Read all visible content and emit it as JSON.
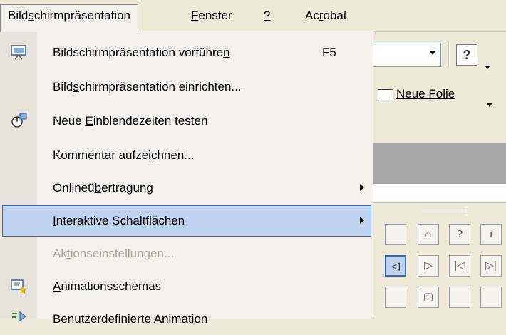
{
  "menubar": {
    "items": [
      {
        "label": "Bildschirmpräsentation",
        "active": true
      },
      {
        "label": "Fenster"
      },
      {
        "label": "?"
      },
      {
        "label": "Acrobat"
      }
    ]
  },
  "menu": {
    "items": [
      {
        "label": "Bildschirmpräsentation vorführen",
        "shortcut": "F5",
        "icon": "slideshow-icon"
      },
      {
        "label": "Bildschirmpräsentation einrichten..."
      },
      {
        "label": "Neue Einblendezeiten testen",
        "icon": "rehearse-timings-icon"
      },
      {
        "label": "Kommentar aufzeichnen..."
      },
      {
        "label": "Onlineübertragung",
        "submenu": true
      },
      {
        "label": "Interaktive Schaltflächen",
        "submenu": true,
        "highlighted": true
      },
      {
        "label": "Aktionseinstellungen...",
        "disabled": true
      },
      {
        "label": "Animationsschemas",
        "icon": "animation-schemes-icon"
      },
      {
        "label": "Benutzerdefinierte Animation",
        "icon": "custom-animation-icon"
      }
    ]
  },
  "toolbar": {
    "new_slide_label": "Neue Folie",
    "help_glyph": "?"
  },
  "palette": {
    "row1": [
      "",
      "⌂",
      "?",
      "i"
    ],
    "row2": [
      "◁",
      "▷",
      "|◁",
      "▷|"
    ],
    "row3": [
      "",
      "▢",
      "",
      ""
    ]
  },
  "colors": {
    "menu_bg": "#f2f1ec",
    "highlight_bg": "#c1d2ee",
    "highlight_border": "#316ac5",
    "disabled_text": "#a8a79c",
    "chrome": "#ece9d8"
  }
}
